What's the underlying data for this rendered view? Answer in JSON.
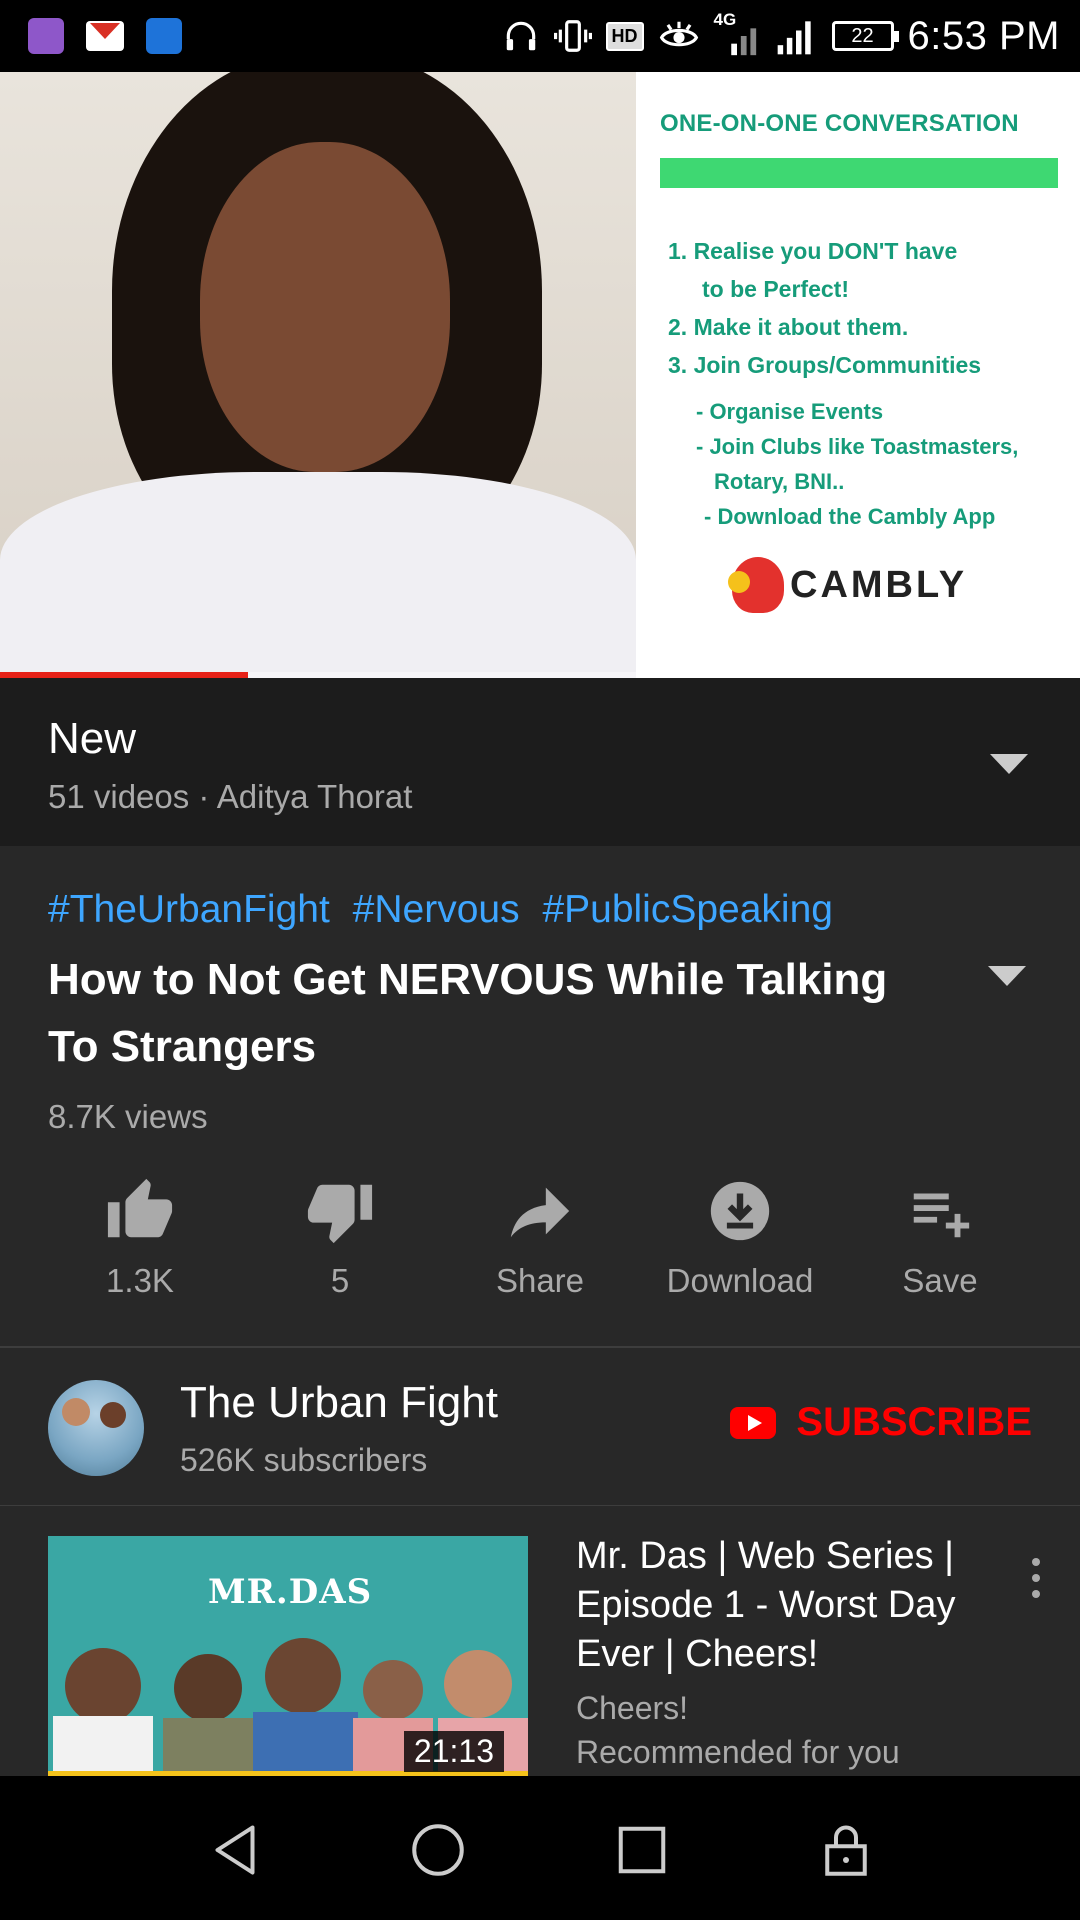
{
  "status_bar": {
    "time": "6:53 PM",
    "battery": "22",
    "network": "4G",
    "hd": "HD",
    "colors": {
      "gallery_app": "#8e57c9",
      "gmail_app": "#d93025",
      "blue_app": "#1e73d9"
    }
  },
  "video": {
    "progress_fraction": 0.23,
    "slide": {
      "title": "ONE-ON-ONE CONVERSATION",
      "items": [
        "1. Realise you DON'T have",
        "to be Perfect!",
        "2. Make it about them.",
        "3. Join Groups/Communities"
      ],
      "subitems": [
        "- Organise Events",
        "- Join Clubs like Toastmasters,",
        "Rotary, BNI..",
        "- Download the Cambly App"
      ],
      "brand": "CAMBLY"
    }
  },
  "playlist": {
    "title": "New",
    "subtitle": "51 videos · Aditya Thorat"
  },
  "details": {
    "tags": [
      "#TheUrbanFight",
      "#Nervous",
      "#PublicSpeaking"
    ],
    "title": "How to Not Get NERVOUS While Talking To Strangers",
    "views": "8.7K views",
    "actions": {
      "like": "1.3K",
      "dislike": "5",
      "share": "Share",
      "download": "Download",
      "save": "Save"
    }
  },
  "channel": {
    "name": "The Urban Fight",
    "subscribers": "526K subscribers",
    "subscribe_label": "SUBSCRIBE",
    "accent": "#ff0000"
  },
  "recommendation": {
    "title": "Mr. Das | Web Series | Episode 1 -  Worst Day Ever | Cheers!",
    "channel": "Cheers!",
    "reason": "Recommended for you",
    "duration": "21:13",
    "thumb_logo": "MR.DAS"
  },
  "navbar": {
    "icons": [
      "back-icon",
      "home-icon",
      "recents-icon",
      "lock-icon"
    ]
  }
}
